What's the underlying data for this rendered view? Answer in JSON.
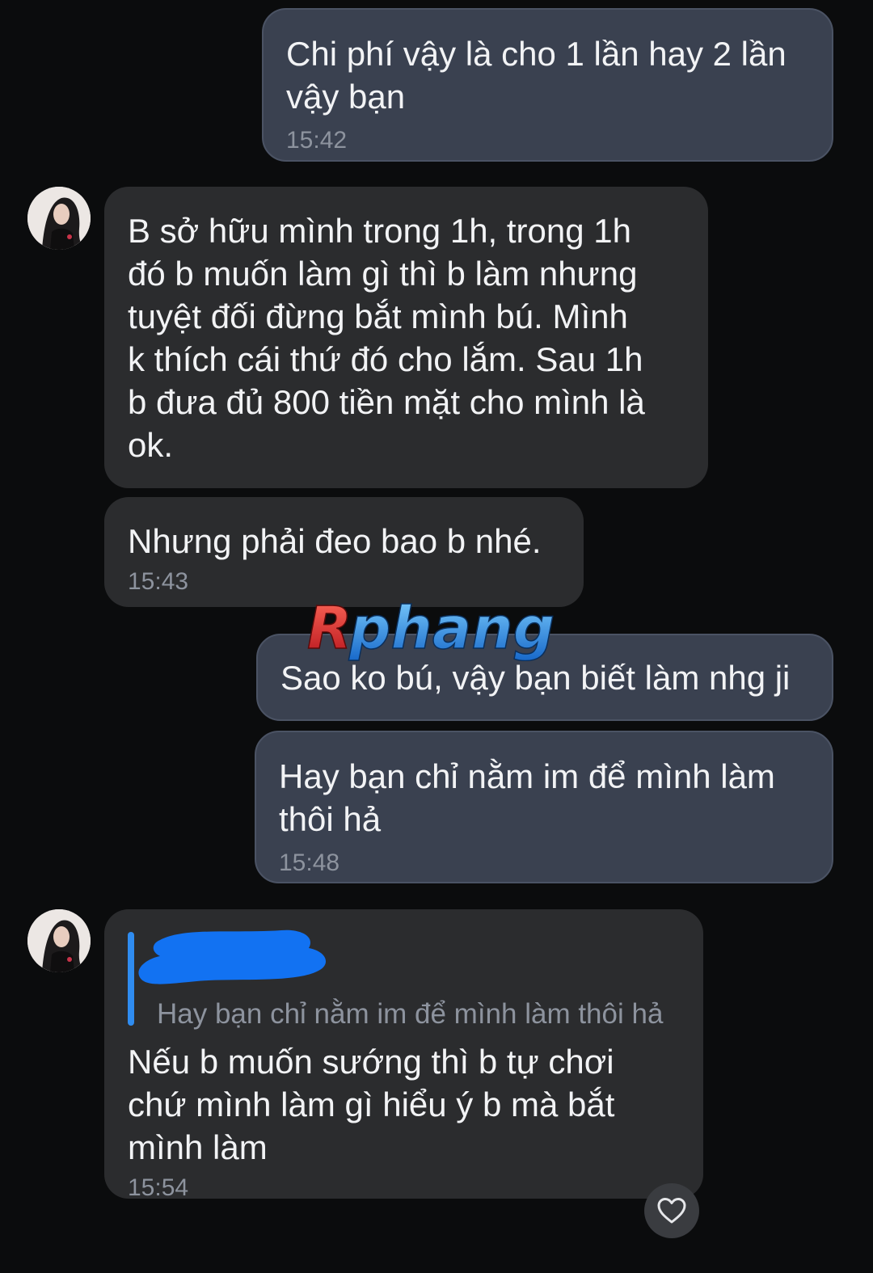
{
  "messages": [
    {
      "id": "m1",
      "direction": "sent",
      "text": "Chi phí vậy là cho 1 lần hay 2 lần\nvậy bạn",
      "time": "15:42"
    },
    {
      "id": "m2",
      "direction": "received",
      "text": "B sở hữu mình trong 1h, trong 1h\nđó b muốn làm gì thì b làm nhưng\ntuyệt đối đừng bắt mình bú. Mình\nk thích cái thứ đó cho lắm. Sau 1h\nb đưa đủ 800 tiền mặt cho mình là\nok."
    },
    {
      "id": "m3",
      "direction": "received",
      "text": "Nhưng phải đeo bao b nhé.",
      "time": "15:43"
    },
    {
      "id": "m4",
      "direction": "sent",
      "text": "Sao ko bú, vậy bạn biết làm nhg ji"
    },
    {
      "id": "m5",
      "direction": "sent",
      "text": "Hay bạn chỉ nằm im để mình làm\nthôi hả",
      "time": "15:48"
    },
    {
      "id": "m6",
      "direction": "received",
      "reply_to": "Hay bạn chỉ nằm im để mình làm thôi hả",
      "text": "Nếu b muốn sướng thì b tự chơi\nchứ mình làm gì hiểu ý b mà bắt\nmình làm",
      "time": "15:54"
    }
  ],
  "watermark": "Rphang",
  "icons": {
    "avatar": "contact-avatar",
    "reaction": "heart-icon",
    "redaction": "blue-scribble"
  },
  "colors": {
    "background": "#0b0c0d",
    "sent_bubble": "#3a4150",
    "received_bubble": "#2b2c2e",
    "reply_bar": "#2f8cf0",
    "redaction": "#1272f2"
  }
}
